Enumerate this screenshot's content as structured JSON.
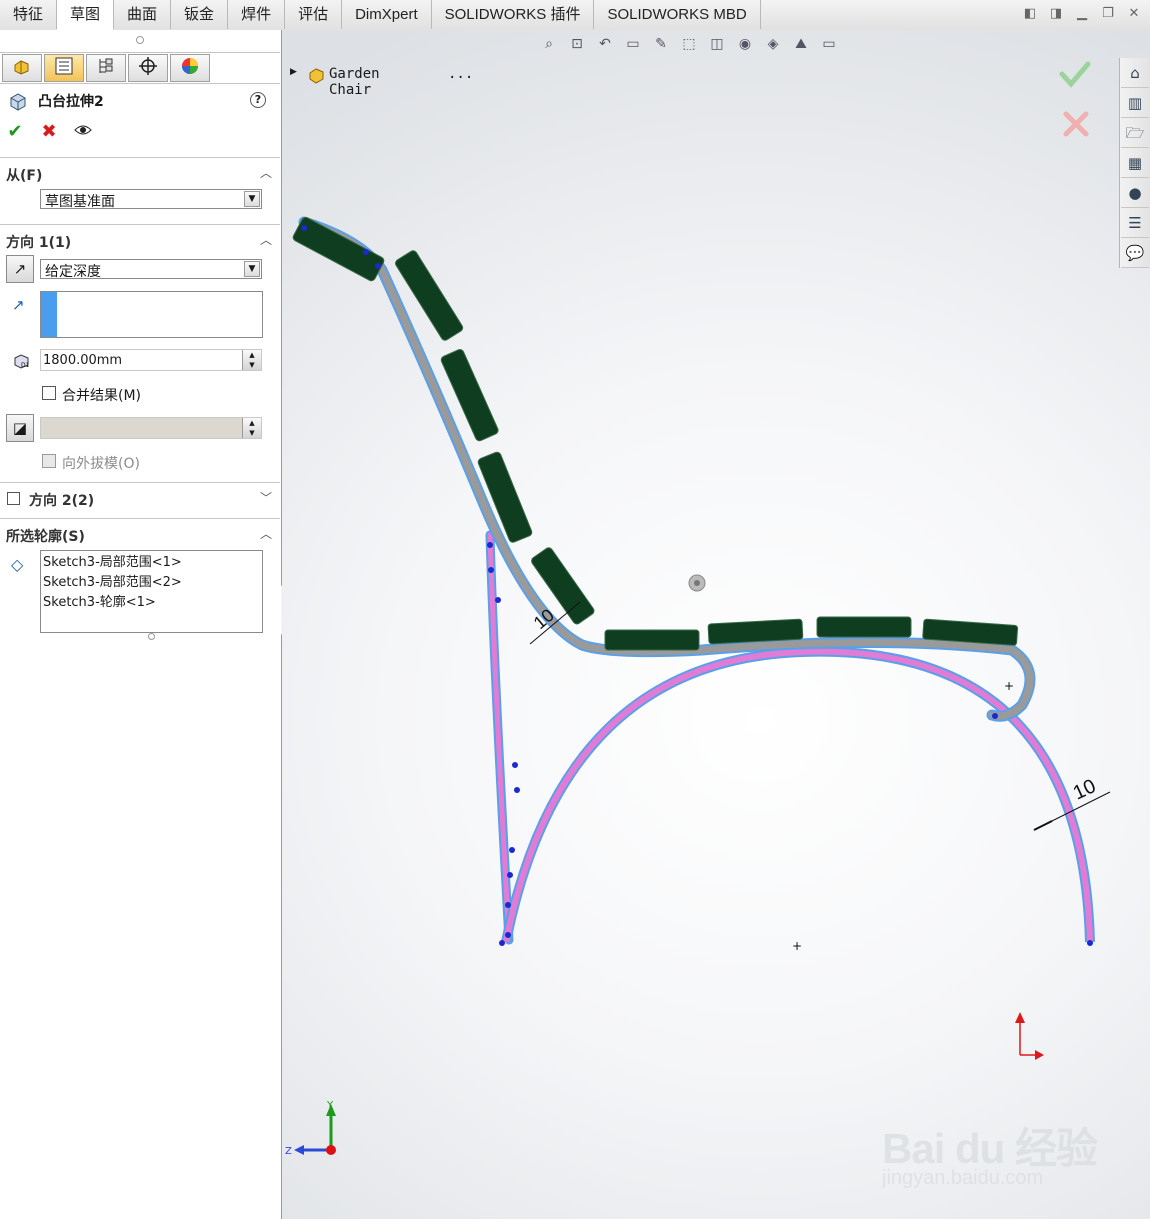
{
  "tabs": [
    "特征",
    "草图",
    "曲面",
    "钣金",
    "焊件",
    "评估",
    "DimXpert",
    "SOLIDWORKS 插件",
    "SOLIDWORKS MBD"
  ],
  "active_tab_index": 1,
  "window_controls": [
    "collapse-left-icon",
    "collapse-right-icon",
    "minimize-icon",
    "restore-icon",
    "close-icon"
  ],
  "panel": {
    "tab_icons": [
      "feature-manager-icon",
      "property-manager-icon",
      "configuration-manager-icon",
      "dimxpert-icon",
      "display-manager-icon"
    ],
    "feature_title": "凸台拉伸2",
    "help_label": "?",
    "sections": {
      "from": {
        "title": "从(F)",
        "start_condition": "草图基准面"
      },
      "direction1": {
        "title": "方向 1(1)",
        "end_condition": "给定深度",
        "depth": "1800.00mm",
        "merge_result": "合并结果(M)",
        "draft_outward": "向外拔模(O)"
      },
      "direction2": {
        "title": "方向 2(2)"
      },
      "selected_contours": {
        "title": "所选轮廓(S)",
        "items": [
          "Sketch3-局部范围<1>",
          "Sketch3-局部范围<2>",
          "Sketch3-轮廓<1>"
        ]
      }
    }
  },
  "viewport": {
    "tree_item": "Garden Chair",
    "tree_more": "...",
    "dimension_upper": "10",
    "dimension_right": "10",
    "axis_y": "Y",
    "axis_z": "Z",
    "watermark_logo": "Bai du 经验",
    "watermark_url": "jingyan.baidu.com"
  },
  "colors": {
    "slat": "#0f3d1f",
    "frame_outer": "#5aa0e8",
    "frame_grey": "#9a9a9a",
    "frame_pink": "#e07cd6",
    "confirm_green": "#9bd49a",
    "cancel_red": "#f0b0b0"
  }
}
